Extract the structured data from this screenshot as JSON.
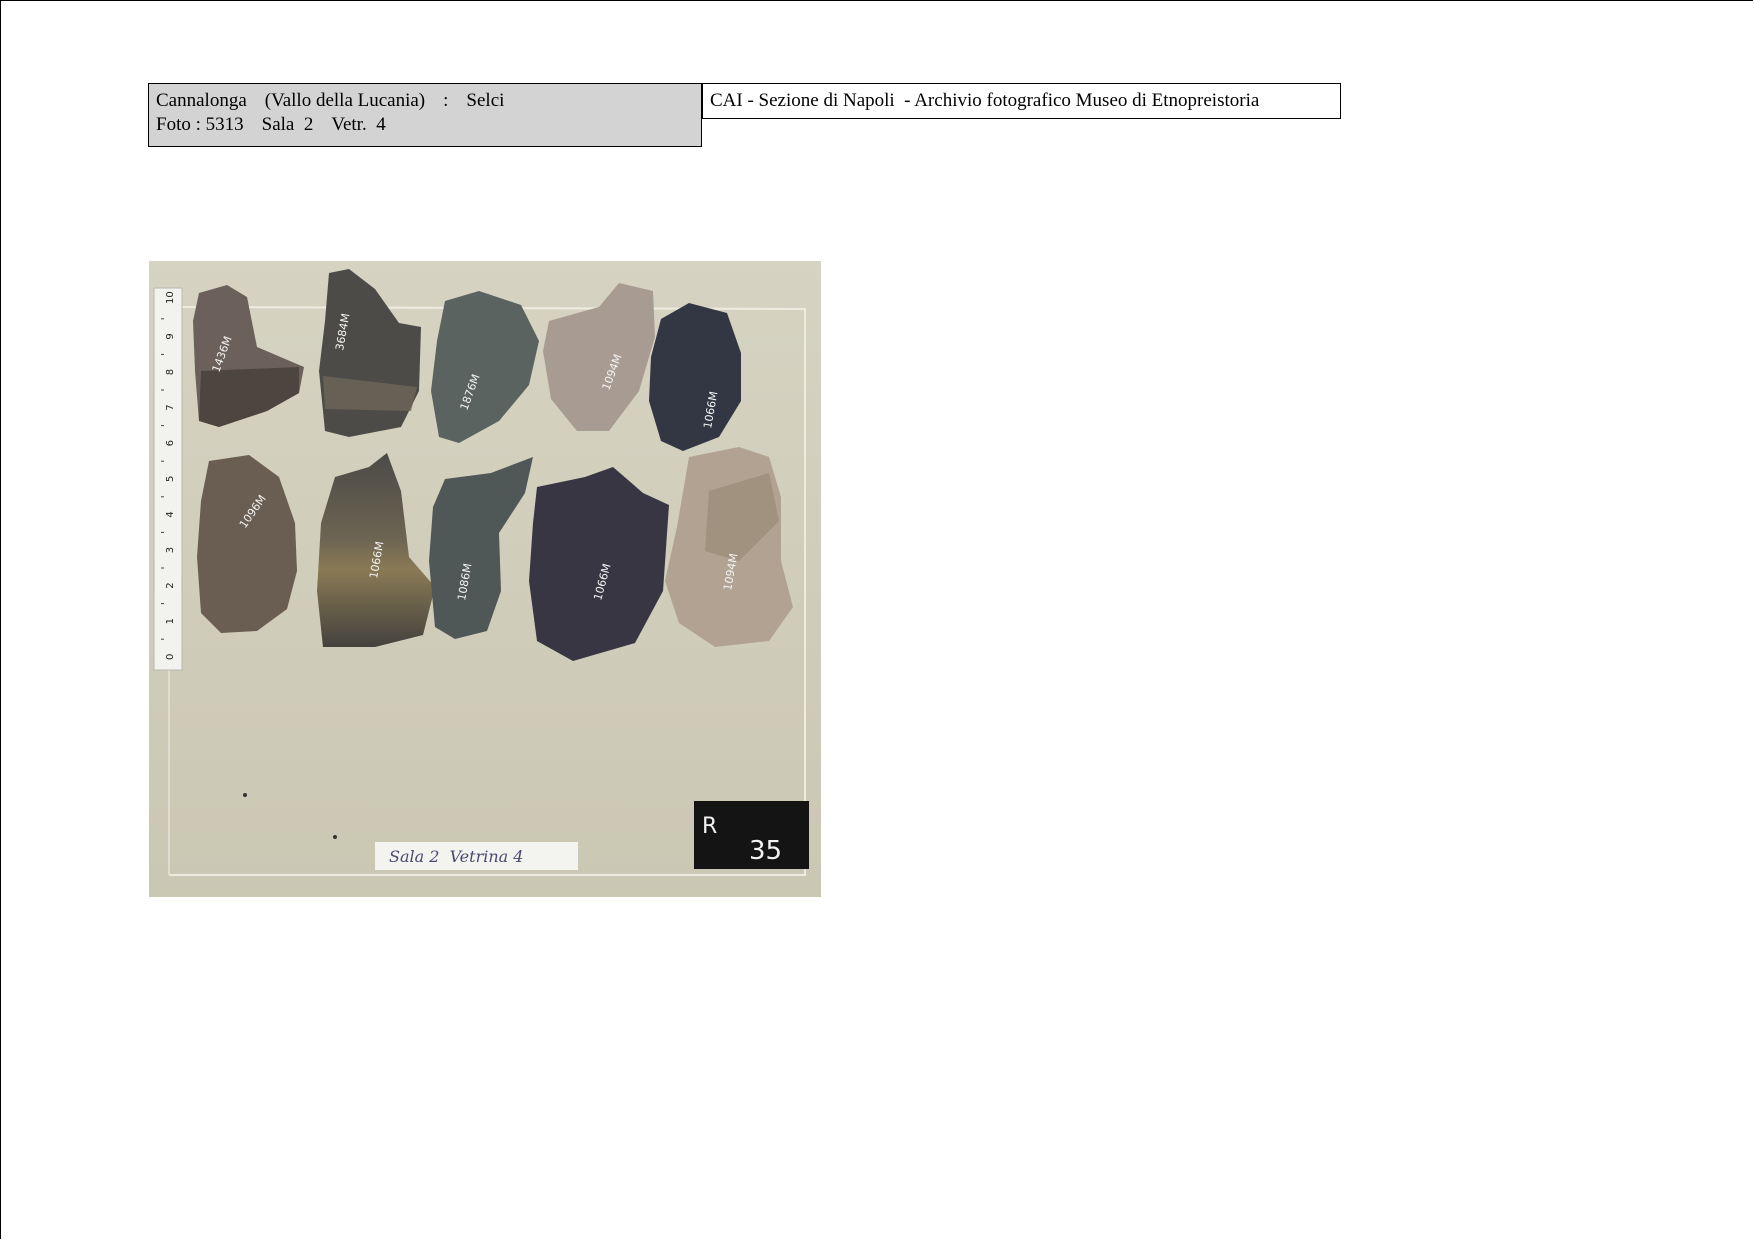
{
  "header": {
    "site": "Cannalonga",
    "locality": "(Vallo della Lucania)",
    "separator": ":",
    "material": "Selci",
    "foto_label": "Foto :",
    "foto_number": "5313",
    "sala": "Sala  2",
    "vetrina": "Vetr.  4",
    "archive": "CAI - Sezione di Napoli  - Archivio fotografico Museo di Etnopreistoria"
  },
  "photo": {
    "showcase_label": "Sala 2  Vetrina 4",
    "tag_letter": "R",
    "tag_number": "35",
    "ruler_ticks": [
      "0",
      "1",
      "2",
      "3",
      "4",
      "5",
      "6",
      "7",
      "8",
      "9",
      "10"
    ]
  }
}
